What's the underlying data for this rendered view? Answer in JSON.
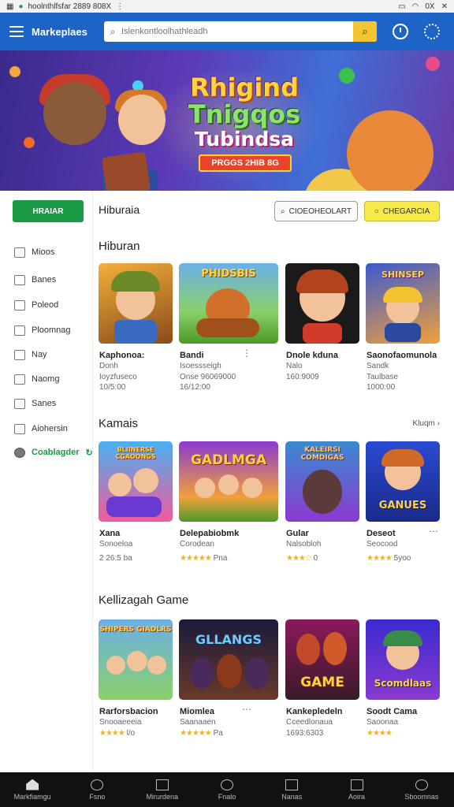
{
  "status_bar": {
    "url_text": "hoolnthlfsfar 2889 808X",
    "battery": "0X"
  },
  "header": {
    "title": "Markeplaes",
    "search_placeholder": "Islenkontloolhathleadh"
  },
  "banner": {
    "line1": "Rhigind",
    "line2": "Tnigqos",
    "line3": "Tubindsa",
    "badge": "PRGGS 2HIB 8G"
  },
  "sidebar": {
    "primary_button": "HRAIAR",
    "items": [
      {
        "label": "Mioos",
        "icon": "gamepad-icon"
      },
      {
        "label": "Banes",
        "icon": "home-icon"
      },
      {
        "label": "Poleod",
        "icon": "edit-icon"
      },
      {
        "label": "Ploomnag",
        "icon": "grid-icon"
      },
      {
        "label": "Nay",
        "icon": "image-icon"
      },
      {
        "label": "Naomg",
        "icon": "chat-icon"
      },
      {
        "label": "Sanes",
        "icon": "bag-icon"
      },
      {
        "label": "Aiohersin",
        "icon": "store-icon"
      },
      {
        "label": "Coablagder",
        "icon": "avatar-icon",
        "active": true
      }
    ]
  },
  "main": {
    "title": "Hiburaia",
    "filter_button": "CIOEOHEOLART",
    "filter_button_yellow": "CHEGARCIA",
    "sections": [
      {
        "title": "Hiburan",
        "see_all": "",
        "cards": [
          {
            "title": "Kaphonoa:",
            "sub": "Donh",
            "meta": "Ioyzfuseco",
            "meta2": "10/5:00"
          },
          {
            "title": "Bandi",
            "sub": "Isoessseigh",
            "meta": "Onse 96069000",
            "meta2": "16/12:00"
          },
          {
            "title": "Dnole kduna",
            "sub": "Nalo",
            "meta": "160:9009"
          },
          {
            "title": "Saonofaomunola",
            "sub": "Sandk",
            "meta": "Taulbase",
            "meta2": "1000:00"
          }
        ]
      },
      {
        "title": "Kamais",
        "see_all": "Kluqm  ›",
        "cards": [
          {
            "title": "Xana",
            "sub": "Sonoeloa",
            "meta": "2 26:5 ba"
          },
          {
            "title": "Delepabiobmk",
            "sub": "Corodean",
            "rating": "★★★★★",
            "meta": "Pna"
          },
          {
            "title": "Gular",
            "sub": "Nalsobloh",
            "rating": "★★★☆",
            "meta": "0"
          },
          {
            "title": "Deseot",
            "sub": "Seocood",
            "rating": "★★★★",
            "meta": "5yoo"
          }
        ]
      },
      {
        "title": "Kellizagah Game",
        "see_all": "",
        "cards": [
          {
            "title": "Rarforsbacion",
            "sub": "Snooaeeeia",
            "rating": "★★★★",
            "meta": "l/o"
          },
          {
            "title": "Miomlea",
            "sub": "Saanaaen",
            "rating": "★★★★★",
            "meta": "Pa"
          },
          {
            "title": "Kankepledeln",
            "sub": "Cceedlonaua",
            "meta": "1693:6303"
          },
          {
            "title": "Soodt Cama",
            "sub": "Saoonaa",
            "rating": "★★★★",
            "meta": ""
          }
        ]
      }
    ]
  },
  "thumbnails": {
    "t2": "PHIDSBIS",
    "t4": "SHINSEP",
    "k1": "BLIINERSE CGAOONGS",
    "k2": "GADLMGA",
    "k3": "KALEIRSI COMDIGAS",
    "k4": "GANUES",
    "g1": "SHIPERS GIADLRS",
    "g2": "GLLANGS",
    "g3": "GAME",
    "g4": "Scomdlaas"
  },
  "bottom_nav": [
    {
      "label": "Markfiamgu",
      "icon": "home-icon"
    },
    {
      "label": "Fsno",
      "icon": "refresh-icon"
    },
    {
      "label": "Mirurdena",
      "icon": "grid-icon"
    },
    {
      "label": "Fnalo",
      "icon": "circle-icon"
    },
    {
      "label": "Nanas",
      "icon": "warning-icon"
    },
    {
      "label": "Aoira",
      "icon": "square-icon"
    },
    {
      "label": "Sboomnas",
      "icon": "circle-icon"
    }
  ]
}
